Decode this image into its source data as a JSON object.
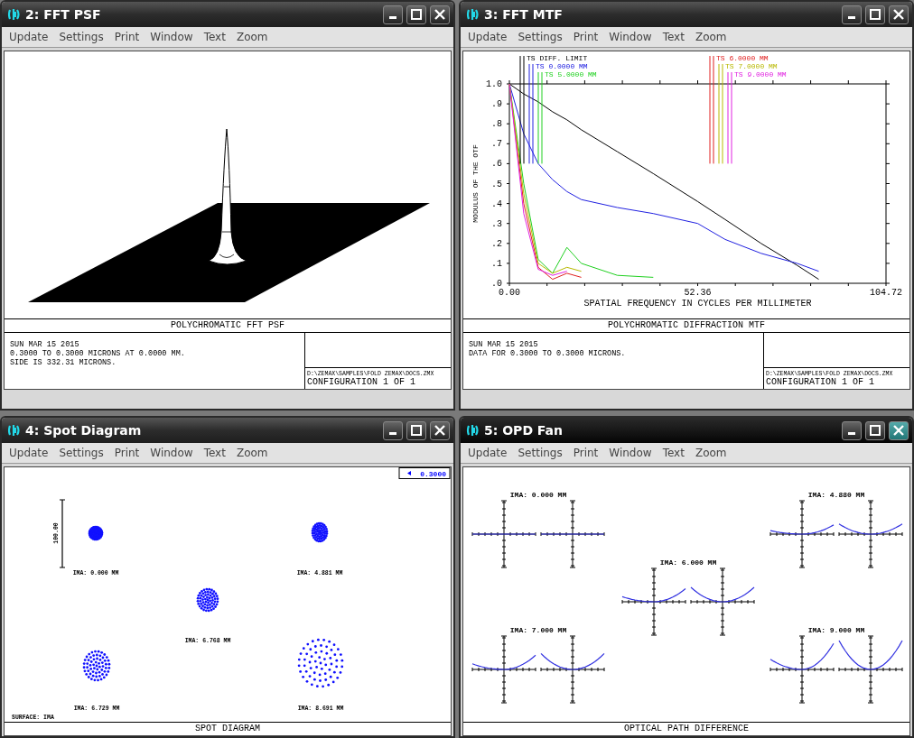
{
  "windows": [
    {
      "kind": "psf",
      "title": "2: FFT PSF",
      "active": false,
      "menu": [
        "Update",
        "Settings",
        "Print",
        "Window",
        "Text",
        "Zoom"
      ],
      "caption": "POLYCHROMATIC FFT PSF",
      "info": [
        "SUN MAR 15 2015",
        "0.3000 TO 0.3000 MICRONS AT 0.0000 MM.",
        "SIDE IS 332.31 MICRONS."
      ],
      "file": "D:\\ZEMAX\\SAMPLES\\FOLD ZEMAX\\DOCS.ZMX",
      "config": "CONFIGURATION 1 OF 1"
    },
    {
      "kind": "mtf",
      "title": "3: FFT MTF",
      "active": false,
      "menu": [
        "Update",
        "Settings",
        "Print",
        "Window",
        "Text",
        "Zoom"
      ],
      "caption": "POLYCHROMATIC DIFFRACTION MTF",
      "info": [
        "SUN MAR 15 2015",
        "DATA FOR 0.3000 TO 0.3000 MICRONS."
      ],
      "file": "D:\\ZEMAX\\SAMPLES\\FOLD ZEMAX\\DOCS.ZMX",
      "config": "CONFIGURATION 1 OF 1",
      "chart_data": {
        "type": "line",
        "xlabel": "SPATIAL FREQUENCY IN CYCLES PER MILLIMETER",
        "ylabel": "MODULUS OF THE OTF",
        "x": [
          0,
          4,
          8,
          12,
          16,
          20,
          30,
          40,
          52.36,
          60,
          70,
          80,
          86
        ],
        "xlim": [
          0,
          104.72
        ],
        "ylim": [
          0,
          1
        ],
        "xticks": [
          {
            "value": 0,
            "label": "0.00"
          },
          {
            "value": 52.36,
            "label": "52.36"
          },
          {
            "value": 104.72,
            "label": "104.72"
          }
        ],
        "yticks": [
          {
            "value": 0,
            "label": ".0"
          },
          {
            "value": 0.1,
            "label": ".1"
          },
          {
            "value": 0.2,
            "label": ".2"
          },
          {
            "value": 0.3,
            "label": ".3"
          },
          {
            "value": 0.4,
            "label": ".4"
          },
          {
            "value": 0.5,
            "label": ".5"
          },
          {
            "value": 0.6,
            "label": ".6"
          },
          {
            "value": 0.7,
            "label": ".7"
          },
          {
            "value": 0.8,
            "label": ".8"
          },
          {
            "value": 0.9,
            "label": ".9"
          },
          {
            "value": 1,
            "label": "1.0"
          }
        ],
        "series": [
          {
            "name": "TS DIFF. LIMIT",
            "color": "#000000",
            "values": [
              1,
              0.95,
              0.91,
              0.86,
              0.82,
              0.77,
              0.66,
              0.55,
              0.41,
              0.32,
              0.2,
              0.09,
              0.02
            ]
          },
          {
            "name": "TS 0.0000 MM",
            "color": "#2020e0",
            "values": [
              1,
              0.75,
              0.6,
              0.52,
              0.46,
              0.42,
              0.38,
              0.35,
              0.3,
              0.22,
              0.15,
              0.1,
              0.06
            ]
          },
          {
            "name": "TS 5.0000 MM",
            "color": "#20d020",
            "values": [
              1,
              0.5,
              0.12,
              0.05,
              0.18,
              0.1,
              0.04,
              0.03,
              null,
              null,
              null,
              null,
              null
            ]
          },
          {
            "name": "TS 6.0000 MM",
            "color": "#e02020",
            "values": [
              1,
              0.4,
              0.08,
              0.02,
              0.05,
              0.03,
              null,
              null,
              null,
              null,
              null,
              null,
              null
            ]
          },
          {
            "name": "TS 7.0000 MM",
            "color": "#b8b800",
            "values": [
              1,
              0.45,
              0.1,
              0.05,
              0.08,
              0.06,
              null,
              null,
              null,
              null,
              null,
              null,
              null
            ]
          },
          {
            "name": "TS 9.0000 MM",
            "color": "#e020e0",
            "values": [
              1,
              0.35,
              0.07,
              0.04,
              0.06,
              null,
              null,
              null,
              null,
              null,
              null,
              null,
              null
            ]
          }
        ]
      }
    },
    {
      "kind": "spot",
      "title": "4: Spot Diagram",
      "active": false,
      "menu": [
        "Update",
        "Settings",
        "Print",
        "Window",
        "Text",
        "Zoom"
      ],
      "wavelength": "0.3000",
      "scale": "100.00",
      "spots": [
        {
          "label": "IMA: 0.000 MM"
        },
        {
          "label": "IMA: 4.881 MM"
        },
        {
          "label": "IMA: 6.768 MM"
        },
        {
          "label": "IMA: 6.729 MM"
        },
        {
          "label": "IMA: 8.691 MM"
        }
      ],
      "surface": "SURFACE: IMA",
      "caption": "SPOT DIAGRAM"
    },
    {
      "kind": "opd",
      "title": "5: OPD Fan",
      "active": true,
      "menu": [
        "Update",
        "Settings",
        "Print",
        "Window",
        "Text",
        "Zoom"
      ],
      "fields": [
        {
          "label": "IMA: 0.000 MM"
        },
        {
          "label": "IMA: 4.880 MM"
        },
        {
          "label": "IMA: 6.000 MM"
        },
        {
          "label": "IMA: 7.000 MM"
        },
        {
          "label": "IMA: 9.000 MM"
        }
      ],
      "caption": "OPTICAL PATH DIFFERENCE"
    }
  ]
}
